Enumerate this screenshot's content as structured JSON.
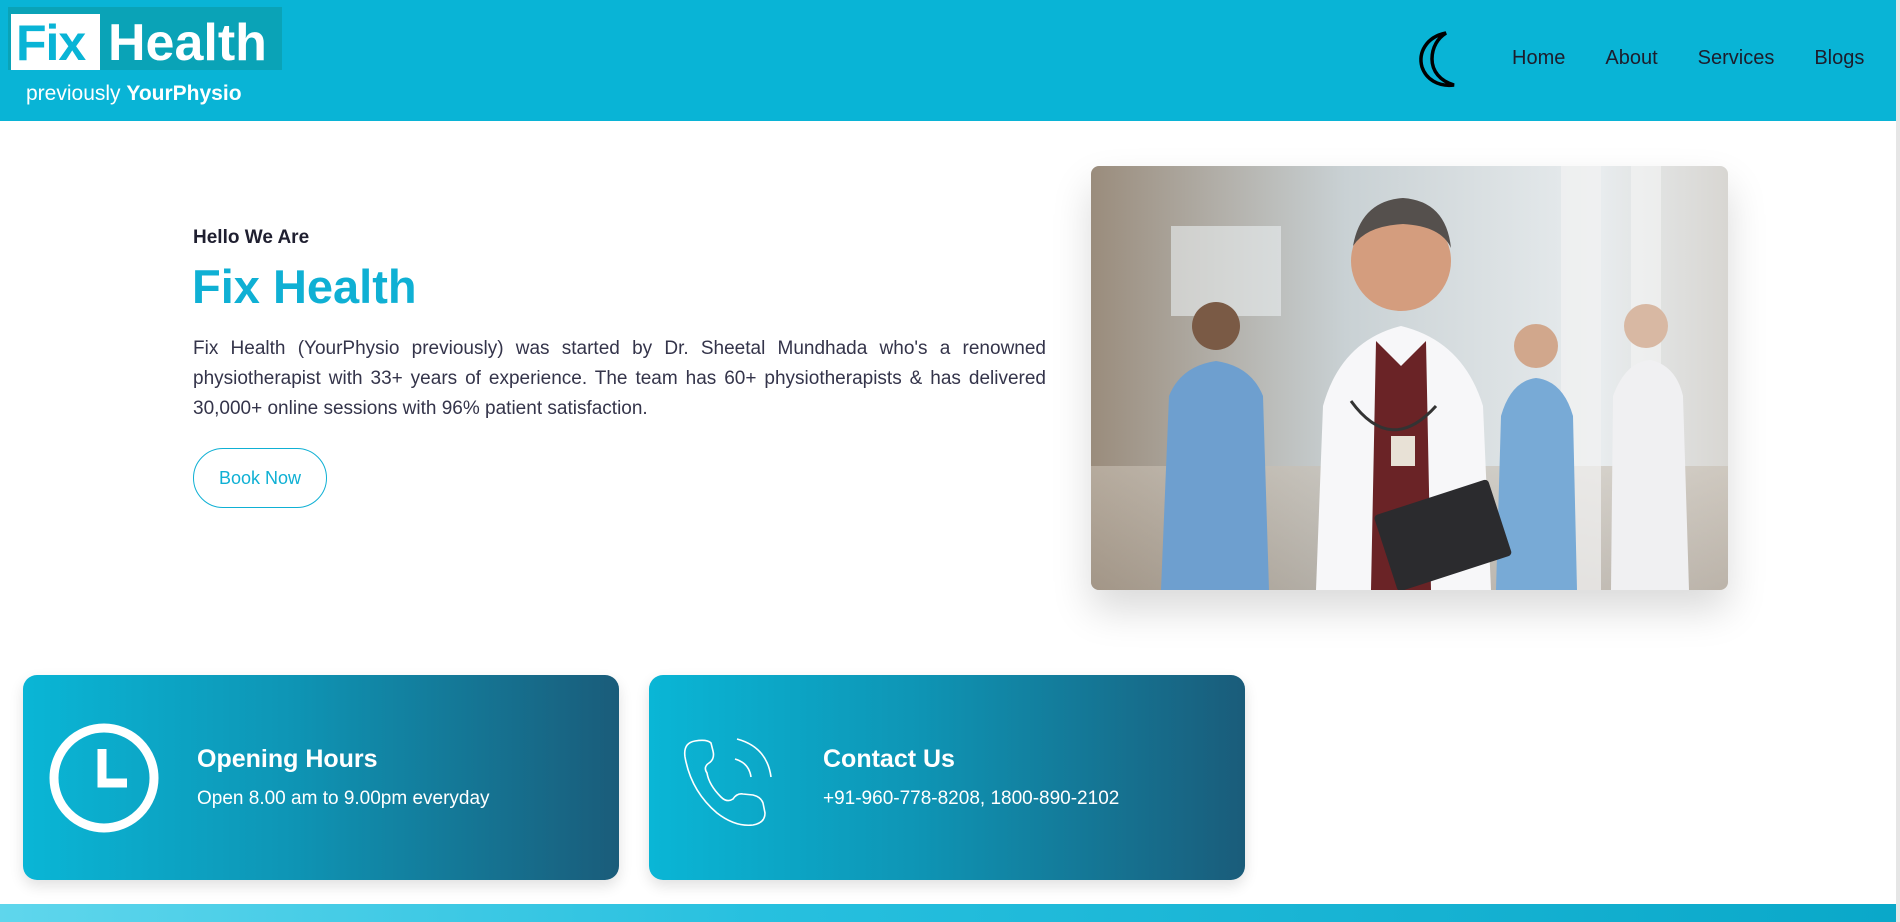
{
  "brand": {
    "logo_fix": "Fix",
    "logo_health": "Health",
    "tagline_prefix": "previously ",
    "tagline_name": "YourPhysio"
  },
  "nav": {
    "theme_toggle_icon": "moon-icon",
    "links": [
      "Home",
      "About",
      "Services",
      "Blogs"
    ]
  },
  "hero": {
    "kicker": "Hello We Are",
    "title": "Fix Health",
    "description": "Fix Health (YourPhysio previously) was started by Dr. Sheetal Mundhada who's a renowned physiotherapist with 33+ years of experience. The team has 60+ physiotherapists & has delivered 30,000+ online sessions with 96% patient satisfaction.",
    "cta": "Book Now"
  },
  "cards": [
    {
      "icon": "clock-icon",
      "title": "Opening Hours",
      "text": "Open 8.00 am to 9.00pm everyday"
    },
    {
      "icon": "phone-icon",
      "title": "Contact Us",
      "text": "+91-960-778-8208, 1800-890-2102"
    }
  ],
  "colors": {
    "brand_cyan": "#09b4d6",
    "card_dark": "#1a5c7a"
  }
}
